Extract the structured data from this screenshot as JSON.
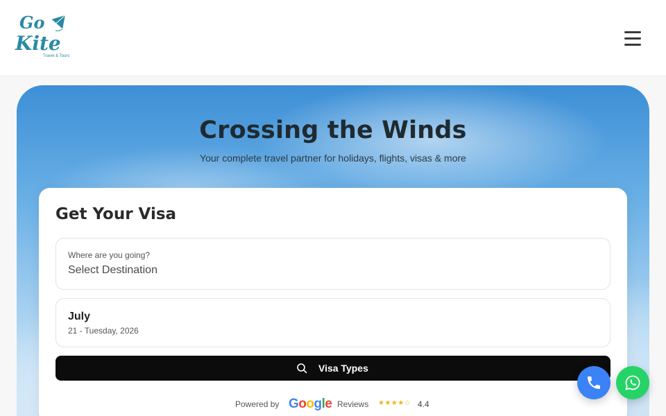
{
  "header": {
    "logo": {
      "word_top": "Go",
      "word_bottom": "Kite",
      "tagline": "Travel & Tours",
      "icon": "kite-icon",
      "color": "#2a8aa6"
    },
    "menu_icon": "hamburger-menu-icon"
  },
  "hero": {
    "title": "Crossing the Winds",
    "subtitle": "Your complete travel partner for holidays, flights, visas & more"
  },
  "visa_form": {
    "title": "Get Your Visa",
    "destination": {
      "label": "Where are you going?",
      "value": "Select Destination"
    },
    "date": {
      "month": "July",
      "day": "21 - Tuesday, 2026"
    },
    "search_button": {
      "icon": "search-icon",
      "label": "Visa Types"
    },
    "powered_by": {
      "prefix": "Powered by",
      "brand": "Google",
      "reviews_label": "Reviews",
      "stars": "★★★★☆",
      "rating": "4.4"
    }
  },
  "floating_actions": {
    "phone_icon": "phone-icon",
    "whatsapp_icon": "whatsapp-icon",
    "phone_color": "#3b82f6",
    "whatsapp_color": "#25d366"
  }
}
